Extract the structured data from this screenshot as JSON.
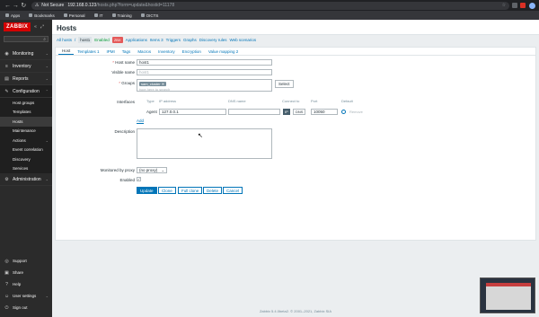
{
  "browser": {
    "security_label": "Not Secure",
    "url_host": "192.168.0.123",
    "url_path": "/hosts.php?form=update&hostid=11178",
    "bookmarks": [
      "Apps",
      "Bookmarks",
      "Personal",
      "IT",
      "Training",
      "OICTS"
    ]
  },
  "sidebar": {
    "logo": "ZABBIX",
    "menu": [
      {
        "label": "Monitoring",
        "icon": "eye-icon"
      },
      {
        "label": "Inventory",
        "icon": "list-icon"
      },
      {
        "label": "Reports",
        "icon": "chart-icon"
      },
      {
        "label": "Configuration",
        "icon": "wrench-icon"
      }
    ],
    "config_items": [
      "Host groups",
      "Templates",
      "Hosts",
      "Maintenance",
      "Actions",
      "Event correlation",
      "Discovery",
      "Services"
    ],
    "admin": "Administration",
    "bottom": [
      "Support",
      "Share",
      "Help",
      "User settings",
      "Sign out"
    ]
  },
  "page": {
    "title": "Hosts",
    "breadcrumbs": {
      "all_hosts": "All hosts",
      "current": "host1",
      "enabled": "Enabled",
      "zbx": "ZBX",
      "applications": "Applications",
      "items": "Items 3",
      "triggers": "Triggers",
      "graphs": "Graphs",
      "discovery": "Discovery rules",
      "web": "Web scenarios"
    },
    "tabs": [
      "Host",
      "Templates 1",
      "IPMI",
      "Tags",
      "Macros",
      "Inventory",
      "Encryption",
      "Value mapping 2"
    ]
  },
  "form": {
    "host_name_label": "Host name",
    "host_name_value": "host1",
    "visible_name_label": "Visible name",
    "visible_name_placeholder": "host1",
    "groups_label": "Groups",
    "group_chip": "sam_cluster",
    "groups_placeholder": "type here to search",
    "select_label": "Select",
    "interfaces_label": "Interfaces",
    "col_type": "Type",
    "col_ip": "IP address",
    "col_dns": "DNS name",
    "col_connect": "Connect to",
    "col_port": "Port",
    "col_default": "Default",
    "agent_label": "Agent",
    "ip_value": "127.0.0.1",
    "ip_btn": "IP",
    "dns_btn": "DNS",
    "port_value": "10050",
    "remove_label": "Remove",
    "add_label": "Add",
    "description_label": "Description",
    "proxy_label": "Monitored by proxy",
    "proxy_value": "(no proxy)",
    "enabled_label": "Enabled",
    "buttons": {
      "update": "Update",
      "clone": "Clone",
      "full_clone": "Full clone",
      "delete": "Delete",
      "cancel": "Cancel"
    }
  },
  "footer": "Zabbix 5.4.0beta2. © 2001–2021, Zabbix SIA",
  "colors": {
    "brand": "#d40000",
    "sidebar": "#2b2b2b",
    "link": "#0275b8"
  }
}
